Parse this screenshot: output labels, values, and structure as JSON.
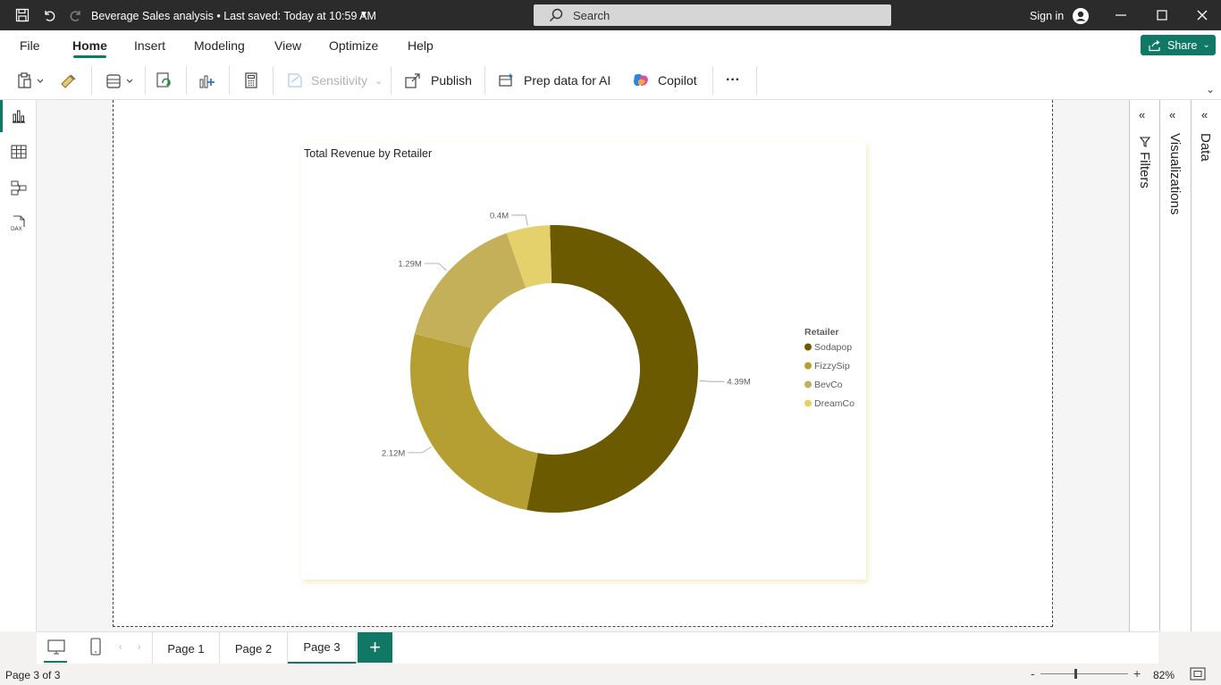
{
  "titlebar": {
    "document_title": "Beverage Sales analysis",
    "last_saved": " • Last saved: Today at 10:59 AM",
    "search_placeholder": "Search",
    "signin": "Sign in"
  },
  "menu": {
    "items": [
      "File",
      "Home",
      "Insert",
      "Modeling",
      "View",
      "Optimize",
      "Help"
    ],
    "active": "Home",
    "share_label": "Share"
  },
  "ribbon": {
    "sensitivity_label": "Sensitivity",
    "publish_label": "Publish",
    "prep_data_label": "Prep data for AI",
    "copilot_label": "Copilot",
    "more_label": "···"
  },
  "panes": {
    "filters": "Filters",
    "visualizations": "Visualizations",
    "data": "Data"
  },
  "pages": {
    "tabs": [
      "Page 1",
      "Page 2",
      "Page 3"
    ],
    "active": "Page 3",
    "add_label": "+"
  },
  "status": {
    "page_indicator": "Page 3 of 3",
    "zoom": "82%",
    "zoom_level": 0.82
  },
  "colors": {
    "accent": "#117865",
    "sodapop": "#6b5a00",
    "fizzysip": "#b59f33",
    "bevco": "#c5b05a",
    "dreamco": "#e5d16b"
  },
  "chart_data": {
    "type": "pie",
    "variant": "donut",
    "title": "Total Revenue by Retailer",
    "legend_title": "Retailer",
    "legend_position": "right",
    "categories": [
      "Sodapop",
      "FizzySip",
      "BevCo",
      "DreamCo"
    ],
    "values": [
      4.39,
      2.12,
      1.29,
      0.4
    ],
    "data_labels": [
      "4.39M",
      "2.12M",
      "1.29M",
      "0.4M"
    ],
    "unit": "M"
  }
}
